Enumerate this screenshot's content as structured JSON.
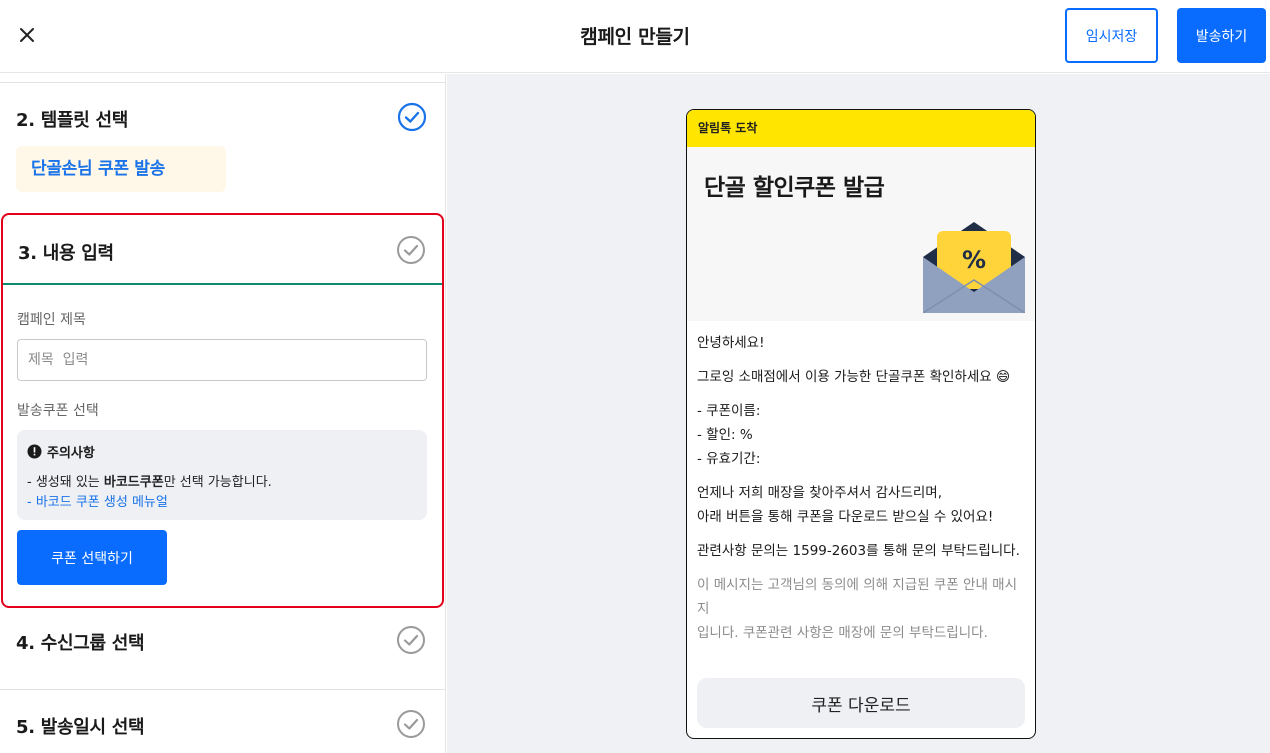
{
  "header": {
    "title": "캠페인 만들기",
    "draft_label": "임시저장",
    "send_label": "발송하기"
  },
  "steps": {
    "template": {
      "title": "2. 템플릿 선택",
      "selected": "단골손님 쿠폰 발송"
    },
    "content": {
      "title": "3. 내용 입력",
      "campaign_title_label": "캠페인 제목",
      "campaign_title_placeholder": "제목  입력",
      "coupon_label": "발송쿠폰 선택",
      "notice_title": "주의사항",
      "notice_prefix": "- 생성돼 있는 ",
      "notice_bold": "바코드쿠폰",
      "notice_suffix": "만 선택 가능합니다.",
      "notice_link": "- 바코드 쿠폰 생성 메뉴얼",
      "coupon_button": "쿠폰 선택하기"
    },
    "recipients": {
      "title": "4. 수신그룹 선택"
    },
    "schedule": {
      "title": "5. 발송일시 선택"
    }
  },
  "preview": {
    "kakao_header": "알림톡 도착",
    "banner_title": "단골 할인쿠폰 발급",
    "envelope_symbol": "%",
    "greeting": "안녕하세요!",
    "intro": "그로잉 소매점에서 이용 가능한 단골쿠폰 확인하세요 😄",
    "coupon_name": "- 쿠폰이름:",
    "discount": "- 할인: %",
    "validity": "- 유효기간:",
    "thanks_1": "언제나 저희 매장을 찾아주셔서 감사드리며,",
    "thanks_2": "아래 버튼을 통해 쿠폰을 다운로드 받으실 수 있어요!",
    "contact": "관련사항 문의는 1599-2603를 통해 문의 부탁드립니다.",
    "disclaimer_1": "이 메시지는 고객님의 동의에 의해 지급된 쿠폰 안내 매시지",
    "disclaimer_2": "입니다. 쿠폰관련 사항은 매장에 문의 부탁드립니다.",
    "download_button": "쿠폰 다운로드"
  },
  "colors": {
    "primary": "#0a6cff",
    "highlight_border": "#e3001b",
    "active_underline": "#0e8a6e",
    "kakao_yellow": "#ffe500",
    "check_done": "#1a73e8",
    "check_pending": "#9a9a9a"
  },
  "icons": {
    "close": "close-icon",
    "done": "check-circle-icon",
    "pending": "check-circle-outline-icon",
    "alert": "alert-icon",
    "coupon": "coupon-envelope-icon"
  }
}
